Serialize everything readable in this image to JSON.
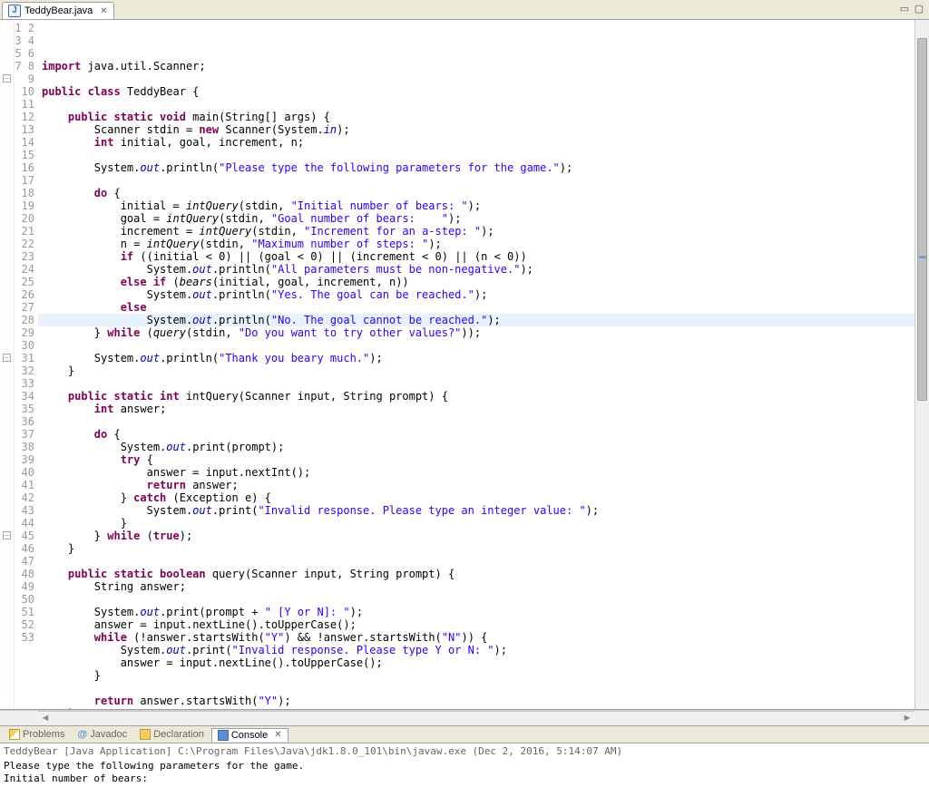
{
  "tab": {
    "filename": "TeddyBear.java"
  },
  "highlighted_line": 24,
  "code_lines": [
    [
      {
        "t": "import",
        "c": "kw"
      },
      {
        "t": " java.util.Scanner;"
      }
    ],
    [],
    [
      {
        "t": "public class",
        "c": "kw"
      },
      {
        "t": " TeddyBear {"
      }
    ],
    [],
    [
      {
        "t": "    "
      },
      {
        "t": "public static void",
        "c": "kw"
      },
      {
        "t": " main(String[] "
      },
      {
        "t": "args",
        "c": ""
      },
      {
        "t": ") {"
      }
    ],
    [
      {
        "t": "        Scanner "
      },
      {
        "t": "stdin",
        "c": ""
      },
      {
        "t": " = "
      },
      {
        "t": "new",
        "c": "kw"
      },
      {
        "t": " Scanner(System."
      },
      {
        "t": "in",
        "c": "fld"
      },
      {
        "t": ");"
      }
    ],
    [
      {
        "t": "        "
      },
      {
        "t": "int",
        "c": "kw"
      },
      {
        "t": " "
      },
      {
        "t": "initial",
        "c": ""
      },
      {
        "t": ", "
      },
      {
        "t": "goal",
        "c": ""
      },
      {
        "t": ", "
      },
      {
        "t": "increment",
        "c": ""
      },
      {
        "t": ", "
      },
      {
        "t": "n",
        "c": ""
      },
      {
        "t": ";"
      }
    ],
    [],
    [
      {
        "t": "        System."
      },
      {
        "t": "out",
        "c": "fld"
      },
      {
        "t": ".println("
      },
      {
        "t": "\"Please type the following parameters for the game.\"",
        "c": "str"
      },
      {
        "t": ");"
      }
    ],
    [],
    [
      {
        "t": "        "
      },
      {
        "t": "do",
        "c": "kw"
      },
      {
        "t": " {"
      }
    ],
    [
      {
        "t": "            "
      },
      {
        "t": "initial",
        "c": ""
      },
      {
        "t": " = "
      },
      {
        "t": "intQuery",
        "c": "mth"
      },
      {
        "t": "("
      },
      {
        "t": "stdin",
        "c": ""
      },
      {
        "t": ", "
      },
      {
        "t": "\"Initial number of bears: \"",
        "c": "str"
      },
      {
        "t": ");"
      }
    ],
    [
      {
        "t": "            "
      },
      {
        "t": "goal",
        "c": ""
      },
      {
        "t": " = "
      },
      {
        "t": "intQuery",
        "c": "mth"
      },
      {
        "t": "("
      },
      {
        "t": "stdin",
        "c": ""
      },
      {
        "t": ", "
      },
      {
        "t": "\"Goal number of bears:    \"",
        "c": "str"
      },
      {
        "t": ");"
      }
    ],
    [
      {
        "t": "            "
      },
      {
        "t": "increment",
        "c": ""
      },
      {
        "t": " = "
      },
      {
        "t": "intQuery",
        "c": "mth"
      },
      {
        "t": "("
      },
      {
        "t": "stdin",
        "c": ""
      },
      {
        "t": ", "
      },
      {
        "t": "\"Increment for an a-step: \"",
        "c": "str"
      },
      {
        "t": ");"
      }
    ],
    [
      {
        "t": "            "
      },
      {
        "t": "n",
        "c": ""
      },
      {
        "t": " = "
      },
      {
        "t": "intQuery",
        "c": "mth"
      },
      {
        "t": "("
      },
      {
        "t": "stdin",
        "c": ""
      },
      {
        "t": ", "
      },
      {
        "t": "\"Maximum number of steps: \"",
        "c": "str"
      },
      {
        "t": ");"
      }
    ],
    [
      {
        "t": "            "
      },
      {
        "t": "if",
        "c": "kw"
      },
      {
        "t": " (("
      },
      {
        "t": "initial",
        "c": ""
      },
      {
        "t": " < 0) || ("
      },
      {
        "t": "goal",
        "c": ""
      },
      {
        "t": " < 0) || ("
      },
      {
        "t": "increment",
        "c": ""
      },
      {
        "t": " < 0) || ("
      },
      {
        "t": "n",
        "c": ""
      },
      {
        "t": " < 0))"
      }
    ],
    [
      {
        "t": "                System."
      },
      {
        "t": "out",
        "c": "fld"
      },
      {
        "t": ".println("
      },
      {
        "t": "\"All parameters must be non-negative.\"",
        "c": "str"
      },
      {
        "t": ");"
      }
    ],
    [
      {
        "t": "            "
      },
      {
        "t": "else if",
        "c": "kw"
      },
      {
        "t": " ("
      },
      {
        "t": "bears",
        "c": "mth"
      },
      {
        "t": "("
      },
      {
        "t": "initial",
        "c": ""
      },
      {
        "t": ", "
      },
      {
        "t": "goal",
        "c": ""
      },
      {
        "t": ", "
      },
      {
        "t": "increment",
        "c": ""
      },
      {
        "t": ", "
      },
      {
        "t": "n",
        "c": ""
      },
      {
        "t": "))"
      }
    ],
    [
      {
        "t": "                System."
      },
      {
        "t": "out",
        "c": "fld"
      },
      {
        "t": ".println("
      },
      {
        "t": "\"Yes. The goal can be reached.\"",
        "c": "str"
      },
      {
        "t": ");"
      }
    ],
    [
      {
        "t": "            "
      },
      {
        "t": "else",
        "c": "kw"
      }
    ],
    [
      {
        "t": "                System."
      },
      {
        "t": "out",
        "c": "fld"
      },
      {
        "t": ".println("
      },
      {
        "t": "\"No. The goal cannot be reached.\"",
        "c": "str"
      },
      {
        "t": ");"
      }
    ],
    [
      {
        "t": "        } "
      },
      {
        "t": "while",
        "c": "kw"
      },
      {
        "t": " ("
      },
      {
        "t": "query",
        "c": "mth"
      },
      {
        "t": "("
      },
      {
        "t": "stdin",
        "c": ""
      },
      {
        "t": ", "
      },
      {
        "t": "\"Do you want to try other values?\"",
        "c": "str"
      },
      {
        "t": "));"
      }
    ],
    [],
    [
      {
        "t": "        System."
      },
      {
        "t": "out",
        "c": "fld"
      },
      {
        "t": ".println("
      },
      {
        "t": "\"Thank you beary much.\"",
        "c": "str"
      },
      {
        "t": ");"
      }
    ],
    [
      {
        "t": "    }"
      }
    ],
    [],
    [
      {
        "t": "    "
      },
      {
        "t": "public static int",
        "c": "kw"
      },
      {
        "t": " intQuery(Scanner "
      },
      {
        "t": "input",
        "c": ""
      },
      {
        "t": ", String "
      },
      {
        "t": "prompt",
        "c": ""
      },
      {
        "t": ") {"
      }
    ],
    [
      {
        "t": "        "
      },
      {
        "t": "int",
        "c": "kw"
      },
      {
        "t": " "
      },
      {
        "t": "answer",
        "c": ""
      },
      {
        "t": ";"
      }
    ],
    [],
    [
      {
        "t": "        "
      },
      {
        "t": "do",
        "c": "kw"
      },
      {
        "t": " {"
      }
    ],
    [
      {
        "t": "            System."
      },
      {
        "t": "out",
        "c": "fld"
      },
      {
        "t": ".print("
      },
      {
        "t": "prompt",
        "c": ""
      },
      {
        "t": ");"
      }
    ],
    [
      {
        "t": "            "
      },
      {
        "t": "try",
        "c": "kw"
      },
      {
        "t": " {"
      }
    ],
    [
      {
        "t": "                "
      },
      {
        "t": "answer",
        "c": ""
      },
      {
        "t": " = "
      },
      {
        "t": "input",
        "c": ""
      },
      {
        "t": ".nextInt();"
      }
    ],
    [
      {
        "t": "                "
      },
      {
        "t": "return",
        "c": "kw"
      },
      {
        "t": " "
      },
      {
        "t": "answer",
        "c": ""
      },
      {
        "t": ";"
      }
    ],
    [
      {
        "t": "            } "
      },
      {
        "t": "catch",
        "c": "kw"
      },
      {
        "t": " (Exception "
      },
      {
        "t": "e",
        "c": ""
      },
      {
        "t": ") {"
      }
    ],
    [
      {
        "t": "                System."
      },
      {
        "t": "out",
        "c": "fld"
      },
      {
        "t": ".print("
      },
      {
        "t": "\"Invalid response. Please type an integer value: \"",
        "c": "str"
      },
      {
        "t": ");"
      }
    ],
    [
      {
        "t": "            }"
      }
    ],
    [
      {
        "t": "        } "
      },
      {
        "t": "while",
        "c": "kw"
      },
      {
        "t": " ("
      },
      {
        "t": "true",
        "c": "kw"
      },
      {
        "t": ");"
      }
    ],
    [
      {
        "t": "    }"
      }
    ],
    [],
    [
      {
        "t": "    "
      },
      {
        "t": "public static boolean",
        "c": "kw"
      },
      {
        "t": " query(Scanner "
      },
      {
        "t": "input",
        "c": ""
      },
      {
        "t": ", String "
      },
      {
        "t": "prompt",
        "c": ""
      },
      {
        "t": ") {"
      }
    ],
    [
      {
        "t": "        String "
      },
      {
        "t": "answer",
        "c": ""
      },
      {
        "t": ";"
      }
    ],
    [],
    [
      {
        "t": "        System."
      },
      {
        "t": "out",
        "c": "fld"
      },
      {
        "t": ".print("
      },
      {
        "t": "prompt",
        "c": ""
      },
      {
        "t": " + "
      },
      {
        "t": "\" [Y or N]: \"",
        "c": "str"
      },
      {
        "t": ");"
      }
    ],
    [
      {
        "t": "        "
      },
      {
        "t": "answer",
        "c": ""
      },
      {
        "t": " = "
      },
      {
        "t": "input",
        "c": ""
      },
      {
        "t": ".nextLine().toUpperCase();"
      }
    ],
    [
      {
        "t": "        "
      },
      {
        "t": "while",
        "c": "kw"
      },
      {
        "t": " (!"
      },
      {
        "t": "answer",
        "c": ""
      },
      {
        "t": ".startsWith("
      },
      {
        "t": "\"Y\"",
        "c": "str"
      },
      {
        "t": ") && !"
      },
      {
        "t": "answer",
        "c": ""
      },
      {
        "t": ".startsWith("
      },
      {
        "t": "\"N\"",
        "c": "str"
      },
      {
        "t": ")) {"
      }
    ],
    [
      {
        "t": "            System."
      },
      {
        "t": "out",
        "c": "fld"
      },
      {
        "t": ".print("
      },
      {
        "t": "\"Invalid response. Please type Y or N: \"",
        "c": "str"
      },
      {
        "t": ");"
      }
    ],
    [
      {
        "t": "            "
      },
      {
        "t": "answer",
        "c": ""
      },
      {
        "t": " = "
      },
      {
        "t": "input",
        "c": ""
      },
      {
        "t": ".nextLine().toUpperCase();"
      }
    ],
    [
      {
        "t": "        }"
      }
    ],
    [],
    [
      {
        "t": "        "
      },
      {
        "t": "return",
        "c": "kw"
      },
      {
        "t": " "
      },
      {
        "t": "answer",
        "c": ""
      },
      {
        "t": ".startsWith("
      },
      {
        "t": "\"Y\"",
        "c": "str"
      },
      {
        "t": ");"
      }
    ],
    [
      {
        "t": "    }"
      }
    ],
    []
  ],
  "fold_markers": [
    5,
    27,
    41
  ],
  "bottom_tabs": {
    "problems": "Problems",
    "javadoc": "Javadoc",
    "declaration": "Declaration",
    "console": "Console"
  },
  "console": {
    "title": "TeddyBear [Java Application] C:\\Program Files\\Java\\jdk1.8.0_101\\bin\\javaw.exe (Dec 2, 2016, 5:14:07 AM)",
    "lines": [
      "Please type the following parameters for the game.",
      "Initial number of bears:"
    ]
  }
}
